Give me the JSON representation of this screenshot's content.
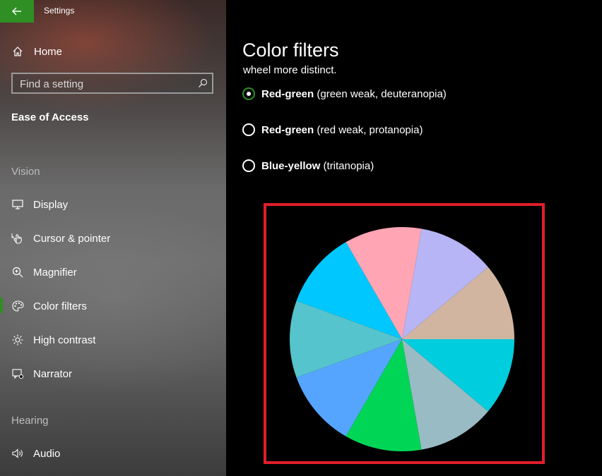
{
  "window": {
    "title": "Settings"
  },
  "sidebar": {
    "home_label": "Home",
    "search": {
      "placeholder": "Find a setting"
    },
    "section_title": "Ease of Access",
    "groups": [
      {
        "title": "Vision",
        "items": [
          {
            "label": "Display",
            "icon": "monitor-icon"
          },
          {
            "label": "Cursor & pointer",
            "icon": "cursor-hand-icon"
          },
          {
            "label": "Magnifier",
            "icon": "magnifier-icon"
          },
          {
            "label": "Color filters",
            "icon": "palette-icon",
            "selected": true
          },
          {
            "label": "High contrast",
            "icon": "brightness-icon"
          },
          {
            "label": "Narrator",
            "icon": "narrator-icon"
          }
        ]
      },
      {
        "title": "Hearing",
        "items": [
          {
            "label": "Audio",
            "icon": "speaker-icon"
          }
        ]
      }
    ]
  },
  "main": {
    "page_title": "Color filters",
    "clipped_description": "wheel more distinct.",
    "options": [
      {
        "bold": "Red-green",
        "detail": " (green weak, deuteranopia)",
        "selected": true
      },
      {
        "bold": "Red-green",
        "detail": " (red weak, protanopia)",
        "selected": false
      },
      {
        "bold": "Blue-yellow",
        "detail": " (tritanopia)",
        "selected": false
      }
    ],
    "color_wheel": {
      "segment_colors": [
        "#D2B5A0",
        "#B7B5F5",
        "#FFA5B4",
        "#00C8FF",
        "#55C4CC",
        "#55A5FF",
        "#00D555",
        "#99BBC4",
        "#00CDDD"
      ]
    }
  },
  "colors": {
    "accent": "#2F8F24",
    "highlight_border": "#E01E2A"
  }
}
